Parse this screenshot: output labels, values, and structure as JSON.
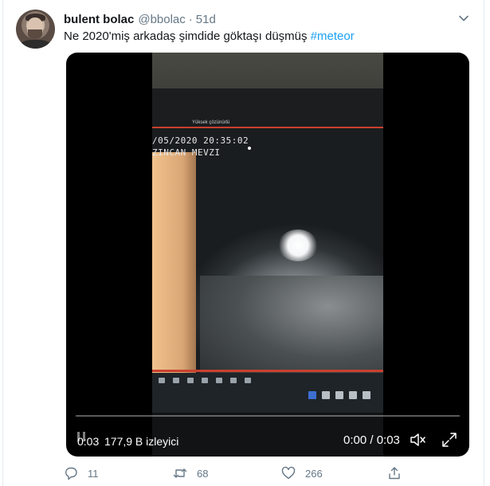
{
  "tweet": {
    "author_name": "bulent bolac",
    "author_handle": "@bbolac",
    "separator": "·",
    "time": "51d",
    "text": "Ne 2020'miş arkadaş şimdide göktaşı düşmüş ",
    "hashtag": "#meteor",
    "icons": [
      "chevron-down-icon",
      "avatar"
    ]
  },
  "video": {
    "osd_date": "/05/2020 20:35:02",
    "osd_location": "ZINCAN MEVZI",
    "menu_text": "Yüksek çözünürlü",
    "elapsed": "0:03",
    "views": "177,9 B izleyici",
    "time_display": "0:00 / 0:03",
    "progress": 0,
    "icons": [
      "pause-icon",
      "mute-icon",
      "fullscreen-icon"
    ]
  },
  "actions": {
    "reply_count": "11",
    "retweet_count": "68",
    "like_count": "266",
    "icons": [
      "reply-icon",
      "retweet-icon",
      "like-icon",
      "share-icon"
    ]
  }
}
